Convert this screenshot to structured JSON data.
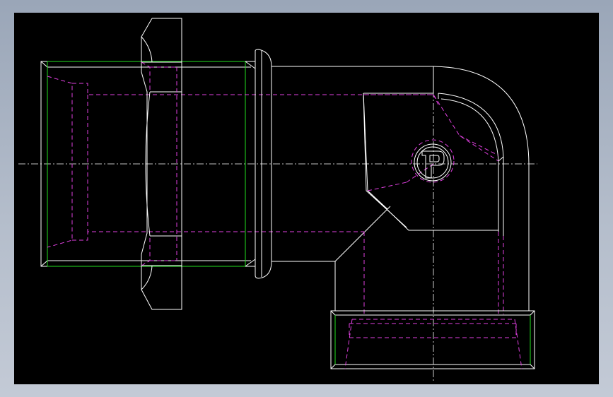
{
  "colors": {
    "background": "#000000",
    "frame": "#aab3c2",
    "outline": "#ffffff",
    "thread_edge": "#22e01e",
    "hidden_line": "#e040e0"
  },
  "logo_icon": "parker-p-logo-icon"
}
